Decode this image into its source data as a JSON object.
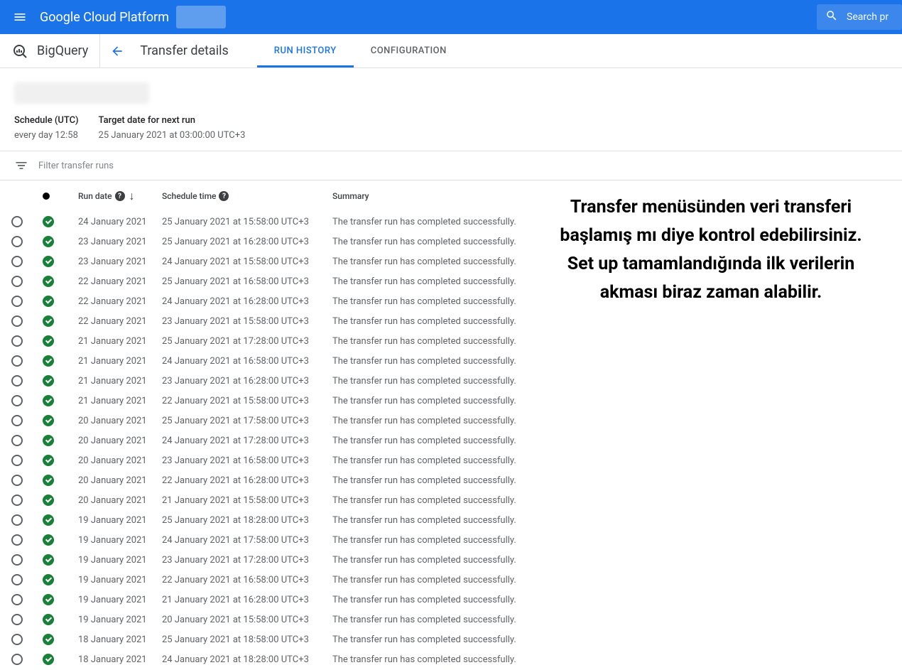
{
  "header": {
    "platform_title": "Google Cloud Platform",
    "search_placeholder": "Search pr"
  },
  "subheader": {
    "bigquery_label": "BigQuery",
    "page_title": "Transfer details",
    "tabs": {
      "run_history": "RUN HISTORY",
      "configuration": "CONFIGURATION"
    }
  },
  "info": {
    "schedule_label": "Schedule (UTC)",
    "schedule_value": "every day 12:58",
    "target_label": "Target date for next run",
    "target_value": "25 January 2021 at 03:00:00 UTC+3"
  },
  "filter": {
    "placeholder": "Filter transfer runs"
  },
  "table": {
    "headers": {
      "run_date": "Run date",
      "schedule_time": "Schedule time",
      "summary": "Summary"
    },
    "success_summary": "The transfer run has completed successfully.",
    "rows": [
      {
        "run_date": "24 January 2021",
        "schedule": "25 January 2021 at 15:58:00 UTC+3"
      },
      {
        "run_date": "23 January 2021",
        "schedule": "25 January 2021 at 16:28:00 UTC+3"
      },
      {
        "run_date": "23 January 2021",
        "schedule": "24 January 2021 at 15:58:00 UTC+3"
      },
      {
        "run_date": "22 January 2021",
        "schedule": "25 January 2021 at 16:58:00 UTC+3"
      },
      {
        "run_date": "22 January 2021",
        "schedule": "24 January 2021 at 16:28:00 UTC+3"
      },
      {
        "run_date": "22 January 2021",
        "schedule": "23 January 2021 at 15:58:00 UTC+3"
      },
      {
        "run_date": "21 January 2021",
        "schedule": "25 January 2021 at 17:28:00 UTC+3"
      },
      {
        "run_date": "21 January 2021",
        "schedule": "24 January 2021 at 16:58:00 UTC+3"
      },
      {
        "run_date": "21 January 2021",
        "schedule": "23 January 2021 at 16:28:00 UTC+3"
      },
      {
        "run_date": "21 January 2021",
        "schedule": "22 January 2021 at 15:58:00 UTC+3"
      },
      {
        "run_date": "20 January 2021",
        "schedule": "25 January 2021 at 17:58:00 UTC+3"
      },
      {
        "run_date": "20 January 2021",
        "schedule": "24 January 2021 at 17:28:00 UTC+3"
      },
      {
        "run_date": "20 January 2021",
        "schedule": "23 January 2021 at 16:58:00 UTC+3"
      },
      {
        "run_date": "20 January 2021",
        "schedule": "22 January 2021 at 16:28:00 UTC+3"
      },
      {
        "run_date": "20 January 2021",
        "schedule": "21 January 2021 at 15:58:00 UTC+3"
      },
      {
        "run_date": "19 January 2021",
        "schedule": "25 January 2021 at 18:28:00 UTC+3"
      },
      {
        "run_date": "19 January 2021",
        "schedule": "24 January 2021 at 17:58:00 UTC+3"
      },
      {
        "run_date": "19 January 2021",
        "schedule": "23 January 2021 at 17:28:00 UTC+3"
      },
      {
        "run_date": "19 January 2021",
        "schedule": "22 January 2021 at 16:58:00 UTC+3"
      },
      {
        "run_date": "19 January 2021",
        "schedule": "21 January 2021 at 16:28:00 UTC+3"
      },
      {
        "run_date": "19 January 2021",
        "schedule": "20 January 2021 at 15:58:00 UTC+3"
      },
      {
        "run_date": "18 January 2021",
        "schedule": "25 January 2021 at 18:58:00 UTC+3"
      },
      {
        "run_date": "18 January 2021",
        "schedule": "24 January 2021 at 18:28:00 UTC+3"
      }
    ]
  },
  "annotation": {
    "text": "Transfer menüsünden veri transferi başlamış mı diye kontrol edebilirsiniz.\nSet up tamamlandığında ilk verilerin akması biraz zaman alabilir."
  }
}
